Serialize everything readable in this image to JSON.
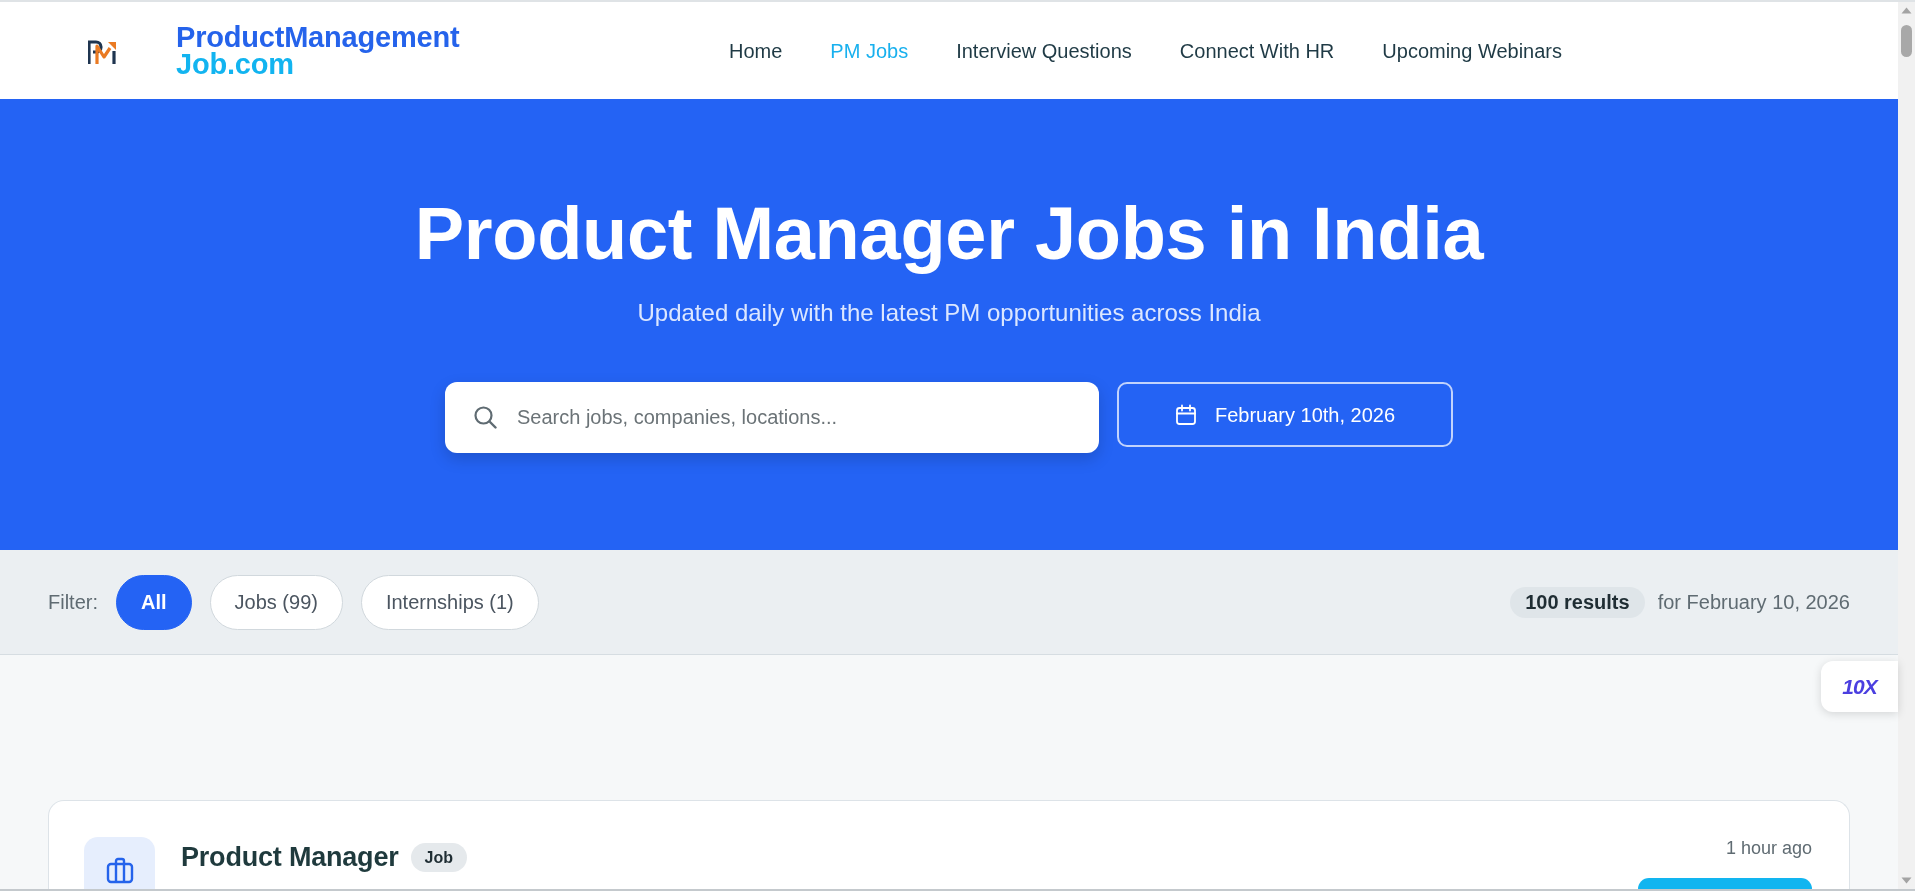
{
  "header": {
    "brand": {
      "line_1": "ProductManagement",
      "line_2": "Job.com"
    },
    "nav": [
      {
        "label": "Home",
        "selected": false
      },
      {
        "label": "PM Jobs",
        "selected": true
      },
      {
        "label": "Interview Questions",
        "selected": false
      },
      {
        "label": "Connect With HR",
        "selected": false
      },
      {
        "label": "Upcoming Webinars",
        "selected": false
      }
    ]
  },
  "hero": {
    "title": "Product Manager Jobs in India",
    "subtitle": "Updated daily with the latest PM opportunities across India",
    "search": {
      "placeholder": "Search jobs, companies, locations..."
    },
    "date_button": "February 10th, 2026"
  },
  "filter_bar": {
    "label": "Filter:",
    "filters": [
      {
        "label": "All",
        "selected": true
      },
      {
        "label": "Jobs (99)",
        "selected": false
      },
      {
        "label": "Internships (1)",
        "selected": false
      }
    ],
    "results_count": "100 results",
    "results_date": "for February 10, 2026"
  },
  "side_badge": "10X",
  "jobs": [
    {
      "title": "Product Manager",
      "type_badge": "Job",
      "posted": "1 hour ago"
    }
  ]
}
